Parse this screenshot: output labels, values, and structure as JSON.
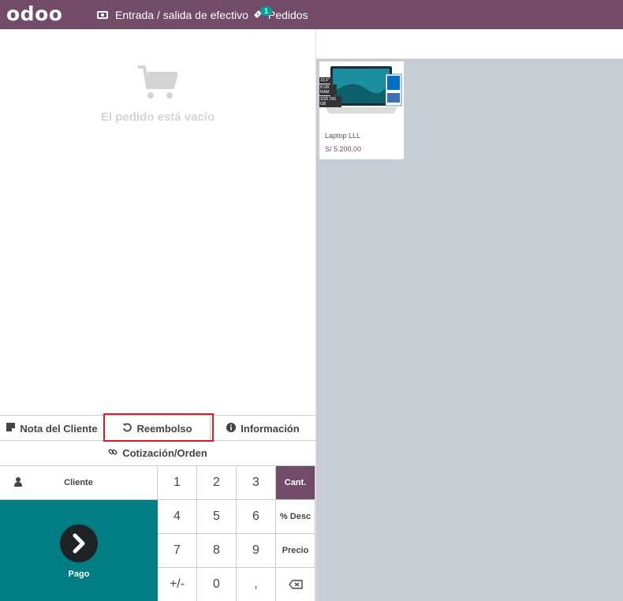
{
  "topbar": {
    "logo_text": "odoo",
    "cash_label": "Entrada / salida de efectivo",
    "orders_label": "Pedidos",
    "orders_badge": "1"
  },
  "order": {
    "empty_message": "El pedido está vacío"
  },
  "products": [
    {
      "name": "Laptop LLL",
      "price": "S/ 5.200,00",
      "image_tags": [
        "15.6\"",
        "8 GB RAM",
        "SSD 256 GB"
      ]
    }
  ],
  "actions": {
    "customer_note": "Nota del Cliente",
    "refund": "Reembolso",
    "info": "Información",
    "quotation": "Cotización/Orden"
  },
  "controls": {
    "customer": "Cliente",
    "payment": "Pago"
  },
  "numpad": {
    "keys": [
      "1",
      "2",
      "3",
      "4",
      "5",
      "6",
      "7",
      "8",
      "9",
      "+/-",
      "0",
      ","
    ],
    "modes": [
      "Cant.",
      "% Desc",
      "Precio"
    ],
    "active_mode": "Cant."
  },
  "colors": {
    "brand": "#714b67",
    "teal": "#017e84",
    "badge": "#00a09d",
    "highlight": "#e01b24"
  }
}
